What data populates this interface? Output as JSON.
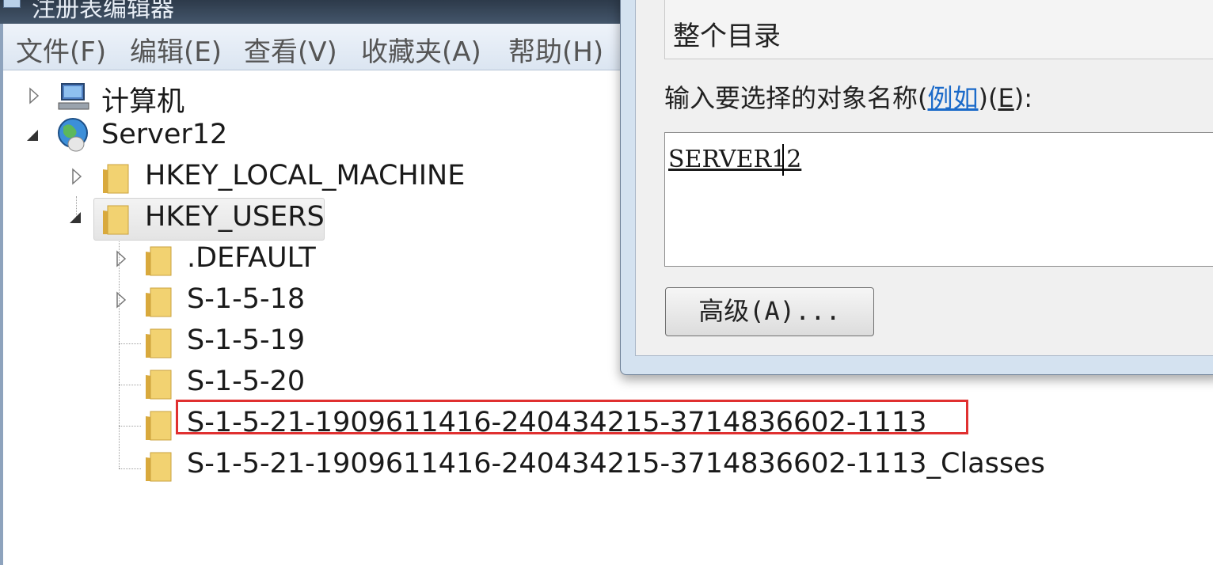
{
  "window": {
    "title": "注册表编辑器"
  },
  "menu": [
    "文件(F)",
    "编辑(E)",
    "查看(V)",
    "收藏夹(A)",
    "帮助(H)"
  ],
  "tree": {
    "computer": "计算机",
    "server": "Server12",
    "hklm": "HKEY_LOCAL_MACHINE",
    "hku": "HKEY_USERS",
    "default": ".DEFAULT",
    "s18": "S-1-5-18",
    "s19": "S-1-5-19",
    "s20": "S-1-5-20",
    "s21": "S-1-5-21-1909611416-240434215-3714836602-1113",
    "s21c": "S-1-5-21-1909611416-240434215-3714836602-1113_Classes"
  },
  "dialog": {
    "location_value": "整个目录",
    "prompt_prefix": "输入要选择的对象名称(",
    "prompt_link": "例如",
    "prompt_mid": ")(",
    "prompt_accel": "E",
    "prompt_suffix": "):",
    "object_names_value": "SERVER12",
    "advanced_button": "高级(A)..."
  },
  "colors": {
    "highlight_box": "#e03030",
    "link": "#1b6ac9",
    "folder": "#e8c25a"
  }
}
